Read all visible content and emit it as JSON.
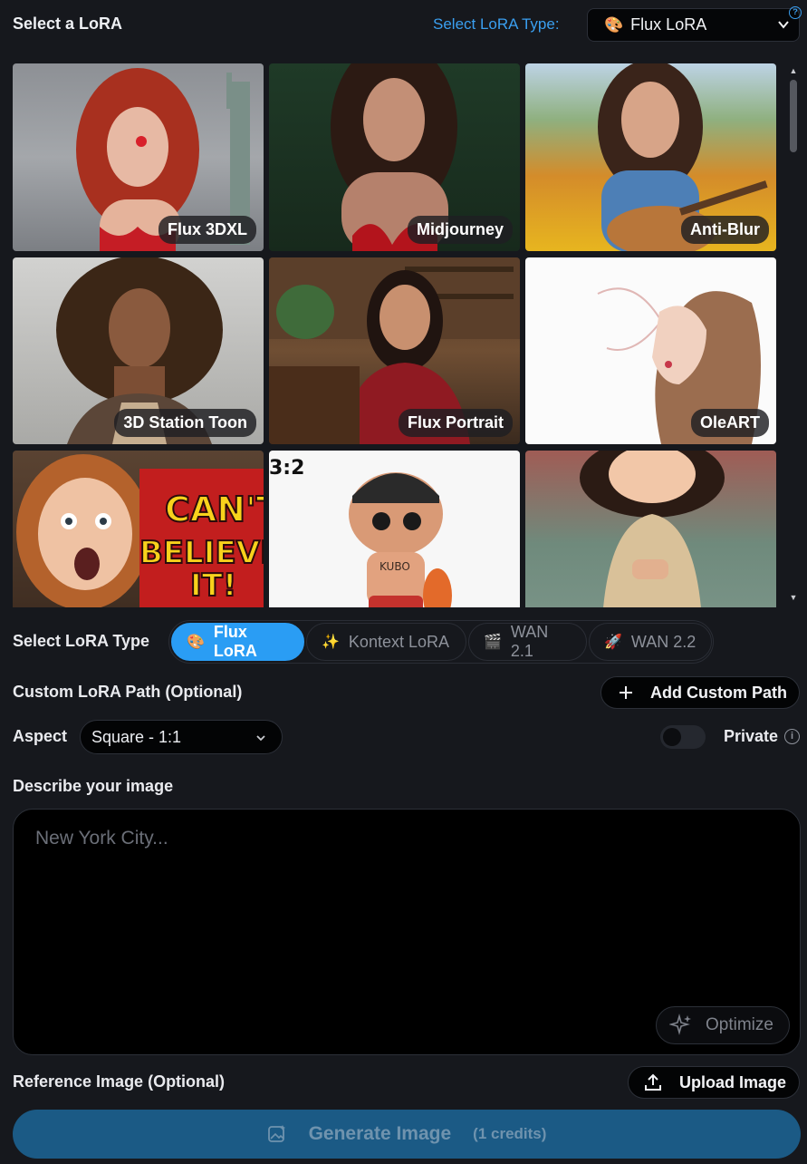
{
  "header": {
    "title": "Select a LoRA",
    "type_label": "Select LoRA Type:",
    "type_selected": "Flux LoRA",
    "type_icon": "🎨",
    "help_glyph": "?"
  },
  "gallery": [
    {
      "label": "Flux 3DXL",
      "theme": "red-hair-liberty"
    },
    {
      "label": "Midjourney",
      "theme": "portrait-green"
    },
    {
      "label": "Anti-Blur",
      "theme": "guitar-flowers"
    },
    {
      "label": "3D Station Toon",
      "theme": "curly-hair"
    },
    {
      "label": "Flux Portrait",
      "theme": "library-portrait"
    },
    {
      "label": "OleART",
      "theme": "sketch-profile"
    },
    {
      "label": "",
      "text_overlay": [
        "CAN'T",
        "BELIEVE!",
        "IT!"
      ],
      "theme": "shocked-kid"
    },
    {
      "label": "",
      "corner_text": "3:2",
      "body_text": "KUBO",
      "theme": "toy-figure"
    },
    {
      "label": "",
      "theme": "cartoon-girl"
    }
  ],
  "lora_type": {
    "label": "Select LoRA Type",
    "options": [
      {
        "label": "Flux LoRA",
        "icon": "🎨",
        "active": true
      },
      {
        "label": "Kontext LoRA",
        "icon": "✨",
        "active": false
      },
      {
        "label": "WAN 2.1",
        "icon": "🎬",
        "active": false
      },
      {
        "label": "WAN 2.2",
        "icon": "🚀",
        "active": false
      }
    ]
  },
  "custom_path": {
    "label": "Custom LoRA Path (Optional)",
    "button": "Add Custom Path"
  },
  "aspect": {
    "label": "Aspect",
    "selected": "Square - 1:1"
  },
  "privacy": {
    "label": "Private",
    "enabled": false,
    "info_glyph": "i"
  },
  "prompt": {
    "label": "Describe your image",
    "placeholder": "New York City...",
    "value": "",
    "optimize_label": "Optimize"
  },
  "reference": {
    "label": "Reference Image (Optional)",
    "button": "Upload Image"
  },
  "generate": {
    "label": "Generate Image",
    "credits": "(1 credits)"
  },
  "colors": {
    "accent": "#2a9df4",
    "background": "#16181d",
    "generate_bg": "#1b5a85"
  }
}
